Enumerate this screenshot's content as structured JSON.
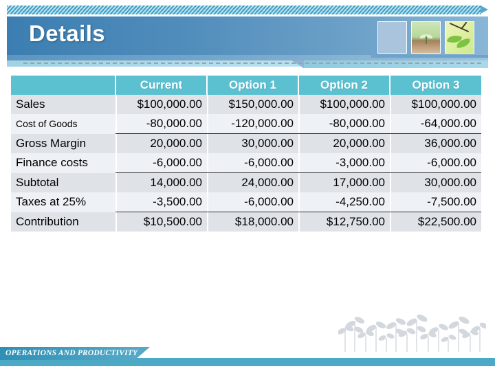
{
  "slide": {
    "title": "Details",
    "footer_text": "OPERATIONS AND PRODUCTIVITY"
  },
  "theme": {
    "banner_blue": "#4C8CBE",
    "header_teal": "#5BC0D0",
    "footer_teal": "#4BA9C6",
    "row_dark": "#DFE3E8",
    "row_light": "#EEF1F5",
    "title_color": "#FFFFFF"
  },
  "header_thumbnails": [
    {
      "name": "blank-blue-thumbnail",
      "caption": ""
    },
    {
      "name": "seedling-in-soil-thumbnail",
      "caption": ""
    },
    {
      "name": "green-leaves-twig-thumbnail",
      "caption": ""
    }
  ],
  "table": {
    "corner_header": "",
    "columns": [
      "Current",
      "Option 1",
      "Option 2",
      "Option 3"
    ],
    "rows": [
      {
        "label": "Sales",
        "small_label": false,
        "rule_top": false,
        "shade": "dark",
        "values": [
          "$100,000.00",
          "$150,000.00",
          "$100,000.00",
          "$100,000.00"
        ]
      },
      {
        "label": "Cost of Goods",
        "small_label": true,
        "rule_top": false,
        "shade": "light",
        "values": [
          "-80,000.00",
          "-120,000.00",
          "-80,000.00",
          "-64,000.00"
        ]
      },
      {
        "label": "Gross Margin",
        "small_label": false,
        "rule_top": true,
        "shade": "dark",
        "values": [
          "20,000.00",
          "30,000.00",
          "20,000.00",
          "36,000.00"
        ]
      },
      {
        "label": "Finance costs",
        "small_label": false,
        "rule_top": false,
        "shade": "light",
        "values": [
          "-6,000.00",
          "-6,000.00",
          "-3,000.00",
          "-6,000.00"
        ]
      },
      {
        "label": "Subtotal",
        "small_label": false,
        "rule_top": true,
        "shade": "dark",
        "values": [
          "14,000.00",
          "24,000.00",
          "17,000.00",
          "30,000.00"
        ]
      },
      {
        "label": "Taxes at 25%",
        "small_label": false,
        "rule_top": false,
        "shade": "light",
        "values": [
          "-3,500.00",
          "-6,000.00",
          "-4,250.00",
          "-7,500.00"
        ]
      },
      {
        "label": "Contribution",
        "small_label": false,
        "rule_top": true,
        "shade": "dark",
        "values": [
          "$10,500.00",
          "$18,000.00",
          "$12,750.00",
          "$22,500.00"
        ]
      }
    ]
  }
}
